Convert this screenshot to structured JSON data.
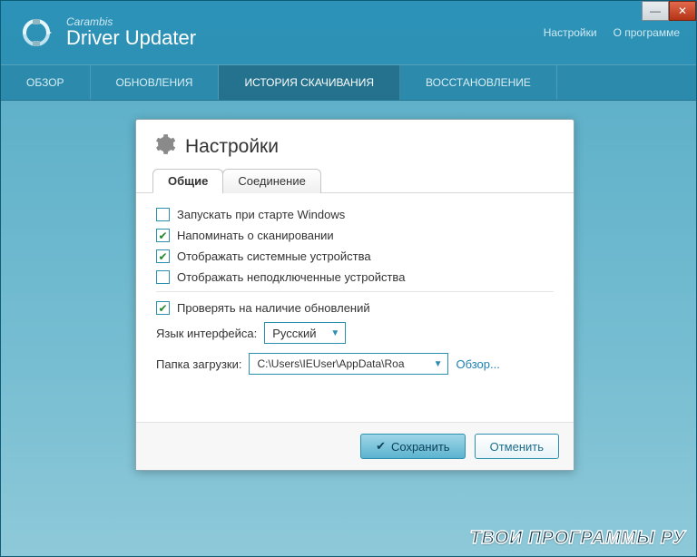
{
  "brand": {
    "small": "Carambis",
    "name": "Driver Updater"
  },
  "titleLinks": {
    "settings": "Настройки",
    "about": "О программе"
  },
  "nav": {
    "items": [
      "ОБЗОР",
      "ОБНОВЛЕНИЯ",
      "ИСТОРИЯ СКАЧИВАНИЯ",
      "ВОССТАНОВЛЕНИЕ"
    ],
    "activeIndex": 2
  },
  "dialog": {
    "title": "Настройки",
    "tabs": {
      "general": "Общие",
      "connection": "Соединение"
    },
    "checks": {
      "startup": {
        "label": "Запускать при старте Windows",
        "checked": false
      },
      "remind": {
        "label": "Напоминать о сканировании",
        "checked": true
      },
      "sysdev": {
        "label": "Отображать системные устройства",
        "checked": true
      },
      "unplugged": {
        "label": "Отображать неподключенные устройства",
        "checked": false
      },
      "updates": {
        "label": "Проверять на наличие обновлений",
        "checked": true
      }
    },
    "languageLabel": "Язык интерфейса:",
    "languageValue": "Русский",
    "folderLabel": "Папка загрузки:",
    "folderValue": "C:\\Users\\IEUser\\AppData\\Roa",
    "browse": "Обзор...",
    "save": "Сохранить",
    "cancel": "Отменить"
  },
  "watermark": "ТВОИ ПРОГРАММЫ РУ"
}
